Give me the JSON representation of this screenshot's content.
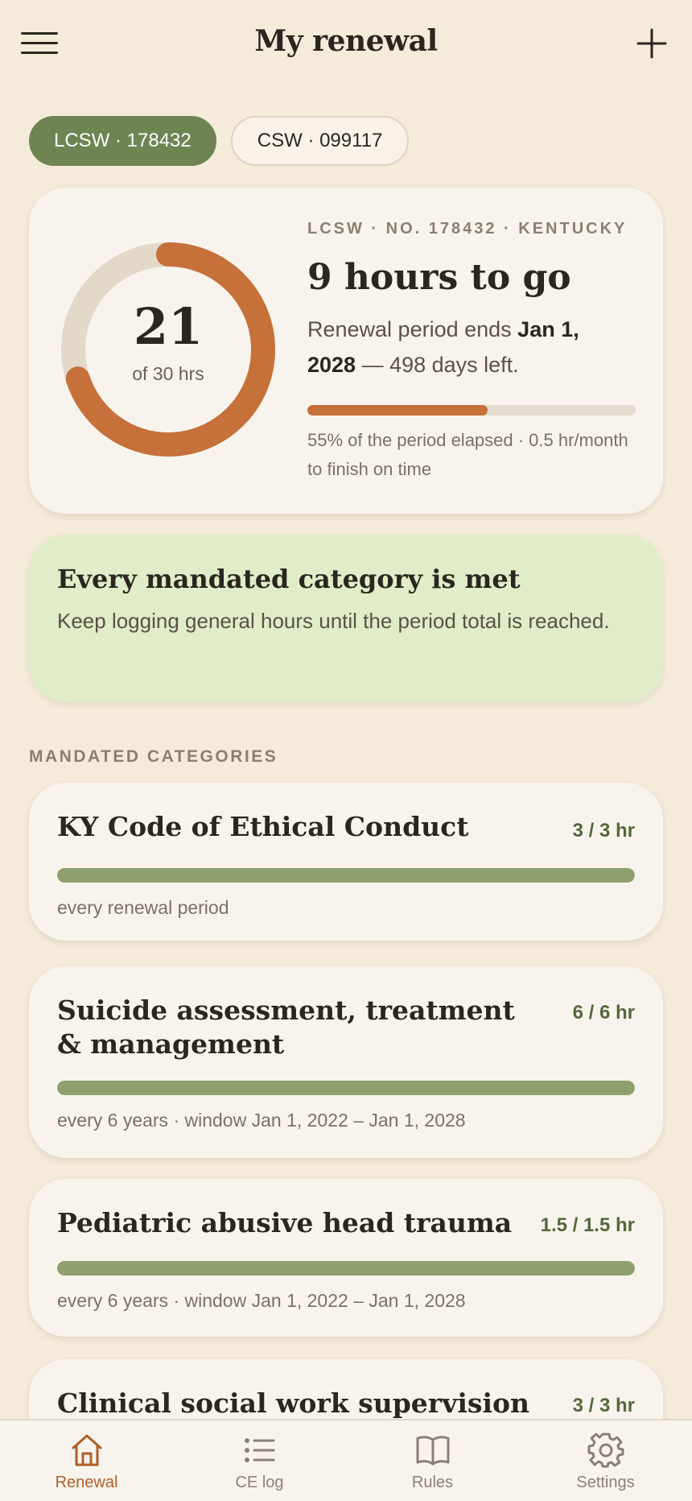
{
  "header": {
    "title": "My renewal",
    "menu_icon": "hamburger-menu-icon",
    "add_icon": "plus-icon"
  },
  "licenses": [
    {
      "label": "LCSW · 178432",
      "selected": true
    },
    {
      "label": "CSW · 099117",
      "selected": false
    }
  ],
  "summary": {
    "hours_done": "21",
    "hours_total_label": "of 30 hrs",
    "progress_fraction": 0.7,
    "eyebrow": "LCSW · NO. 178432 · KENTUCKY",
    "title": "9 hours to go",
    "desc_prefix": "Renewal period ends ",
    "desc_date": "Jan 1, 2028",
    "desc_suffix": " — 498 days left.",
    "period_elapsed_fraction": 0.55,
    "note": "55% of the period elapsed · 0.5 hr/month to finish on time"
  },
  "notice": {
    "title": "Every mandated category is met",
    "body": "Keep logging general hours until the period total is reached."
  },
  "section_label": "MANDATED CATEGORIES",
  "categories": [
    {
      "title": "KY Code of Ethical Conduct",
      "value": "3 / 3 hr",
      "fraction": 1.0,
      "note": "every renewal period"
    },
    {
      "title": "Suicide assessment, treatment & management",
      "value": "6 / 6 hr",
      "fraction": 1.0,
      "note": "every 6 years · window Jan 1, 2022 – Jan 1, 2028"
    },
    {
      "title": "Pediatric abusive head trauma",
      "value": "1.5 / 1.5 hr",
      "fraction": 1.0,
      "note": "every 6 years · window Jan 1, 2022 – Jan 1, 2028"
    },
    {
      "title": "Clinical social work supervision",
      "value": "3 / 3 hr",
      "fraction": 1.0,
      "note": ""
    }
  ],
  "tabs": [
    {
      "label": "Renewal",
      "icon": "home-icon",
      "active": true
    },
    {
      "label": "CE log",
      "icon": "list-icon",
      "active": false
    },
    {
      "label": "Rules",
      "icon": "book-icon",
      "active": false
    },
    {
      "label": "Settings",
      "icon": "gear-icon",
      "active": false
    }
  ],
  "colors": {
    "background": "#f5ebdb",
    "accent_orange": "#c6703a",
    "accent_green": "#6e8452",
    "complete_bar": "#8ea06e",
    "notice_bg": "#e0edc8"
  }
}
